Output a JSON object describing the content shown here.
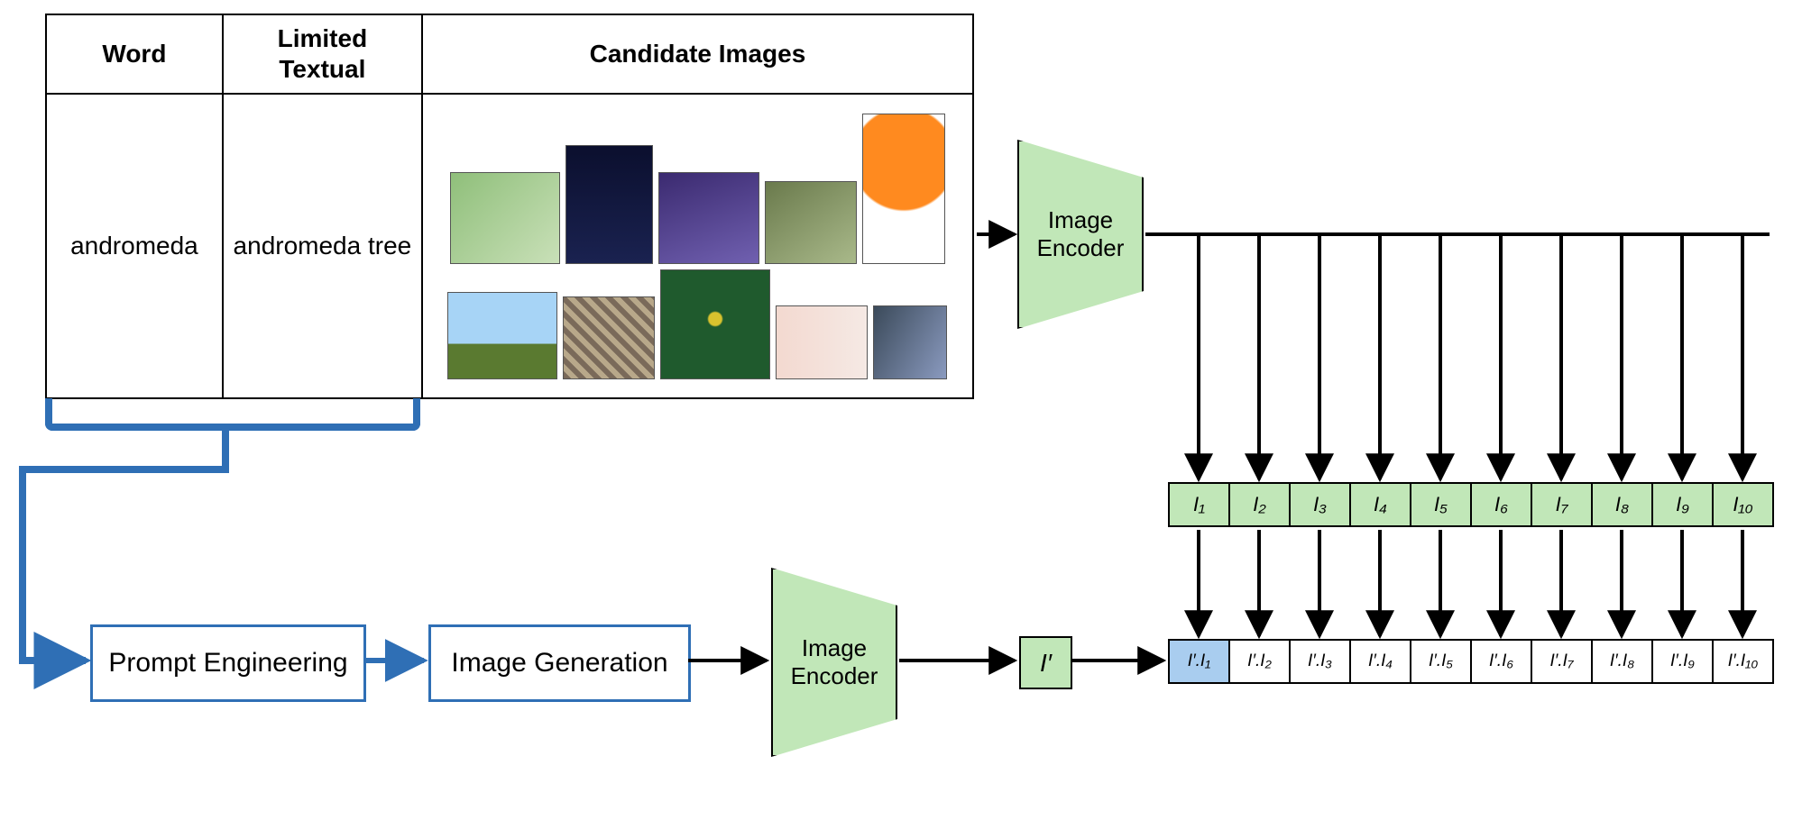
{
  "table": {
    "headers": {
      "word": "Word",
      "limited_textual": "Limited Textual",
      "candidate_images": "Candidate Images"
    },
    "row": {
      "word": "andromeda",
      "limited_textual": "andromeda tree"
    }
  },
  "image_encoder_label": "Image Encoder",
  "prompt_engineering_label": "Prompt Engineering",
  "image_generation_label": "Image Generation",
  "i_prime_label": "I′",
  "embeddings": [
    "I₁",
    "I₂",
    "I₃",
    "I₄",
    "I₅",
    "I₆",
    "I₇",
    "I₈",
    "I₉",
    "I₁₀"
  ],
  "scores": [
    "I′.I₁",
    "I′.I₂",
    "I′.I₃",
    "I′.I₄",
    "I′.I₅",
    "I′.I₆",
    "I′.I₇",
    "I′.I₈",
    "I′.I₉",
    "I′.I₁₀"
  ],
  "selected_score_index": 0
}
